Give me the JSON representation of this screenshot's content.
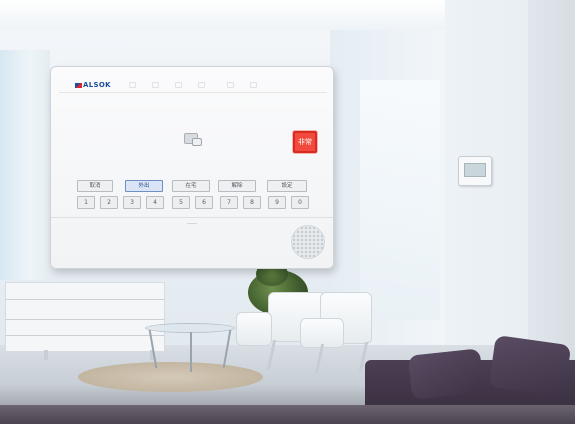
{
  "panel": {
    "brand": "ALSOK",
    "emergency_label": "非常",
    "mode_buttons": [
      {
        "label": "取消",
        "active": false
      },
      {
        "label": "外出",
        "active": true
      },
      {
        "label": "在宅",
        "active": false
      },
      {
        "label": "解除",
        "active": false
      },
      {
        "label": "設定",
        "active": false
      }
    ],
    "keys": [
      "1",
      "2",
      "3",
      "4",
      "5",
      "6",
      "7",
      "8",
      "9",
      "0"
    ],
    "icons": [
      "card-reader-icon",
      "speaker-grille-icon"
    ],
    "colors": {
      "emergency": "#f24a3c",
      "brand_blue": "#1d4e9a",
      "active_mode": "#d9e5f7"
    }
  }
}
